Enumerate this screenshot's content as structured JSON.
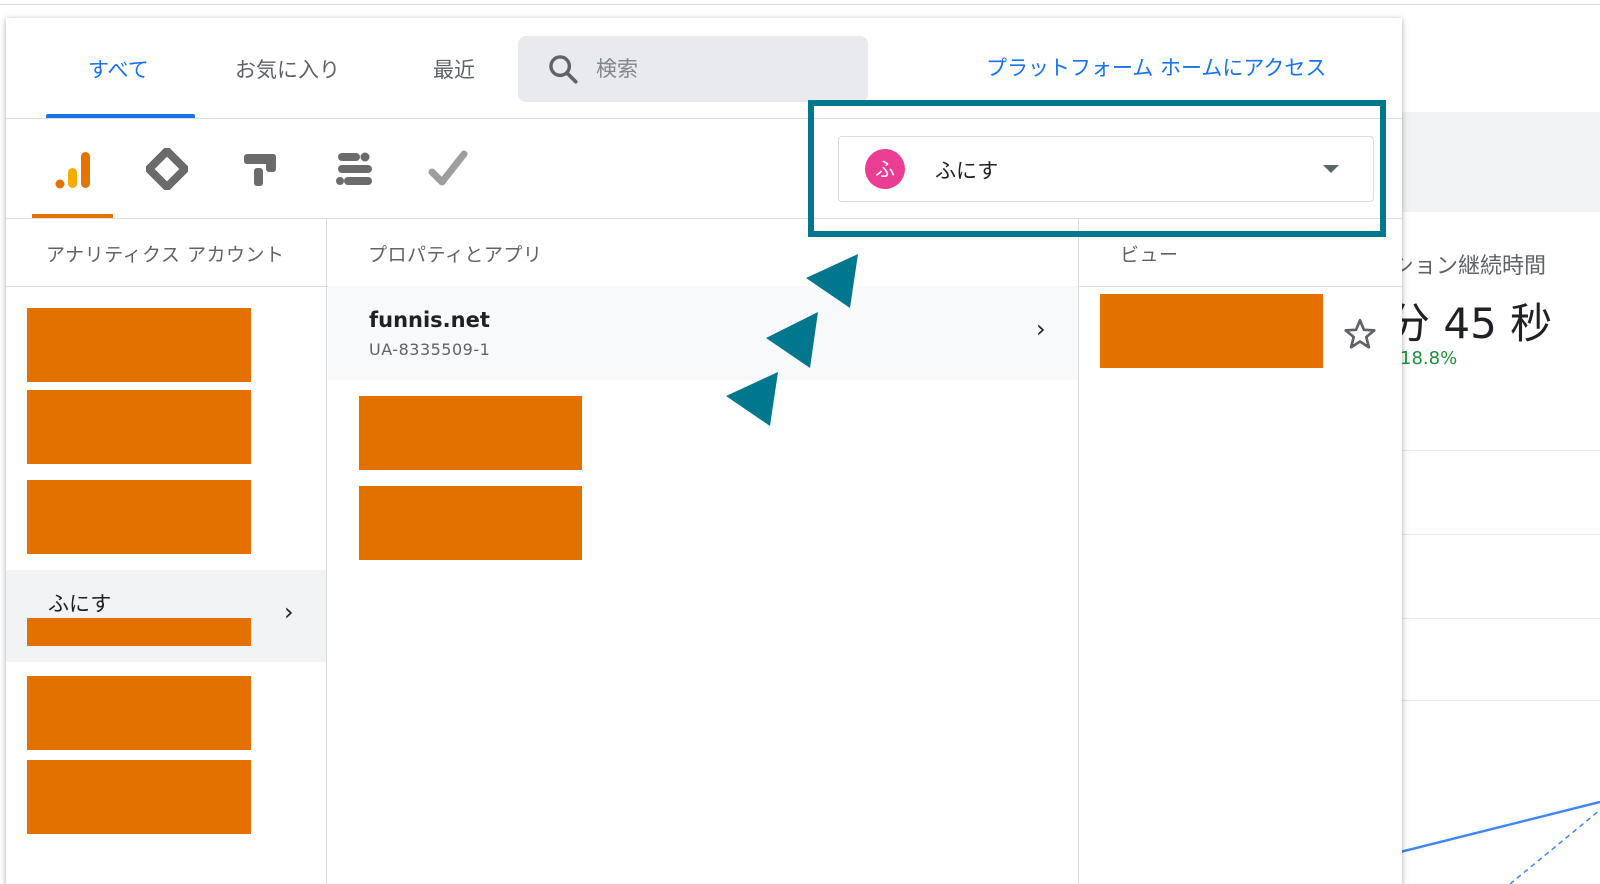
{
  "background": {
    "metric_label": "ション継続時間",
    "metric_value": "分 45 秒",
    "metric_change": "18.8%"
  },
  "tabs": [
    {
      "label": "すべて",
      "active": true
    },
    {
      "label": "お気に入り",
      "active": false
    },
    {
      "label": "最近",
      "active": false
    }
  ],
  "search": {
    "placeholder": "検索",
    "value": ""
  },
  "platform_link": "プラットフォーム ホームにアクセス",
  "products": [
    {
      "icon": "analytics-icon",
      "selected": true
    },
    {
      "icon": "tag-manager-icon",
      "selected": false
    },
    {
      "icon": "optimize-icon",
      "selected": false
    },
    {
      "icon": "data-studio-icon",
      "selected": false
    },
    {
      "icon": "surveys-icon",
      "selected": false
    }
  ],
  "account_selector": {
    "avatar": "ふ",
    "name": "ふにす",
    "avatar_color": "#ea3d93"
  },
  "columns": {
    "accounts": {
      "header": "アナリティクス アカウント",
      "selected_label": "ふにす"
    },
    "properties": {
      "header": "プロパティとアプリ",
      "selected_name": "funnis.net",
      "selected_id": "UA-8335509-1"
    },
    "views": {
      "header": "ビュー"
    }
  },
  "colors": {
    "accent": "#1a73e8",
    "analytics_orange": "#e37400",
    "redaction": "#e27100",
    "annotation_teal": "#00778d"
  },
  "chevron": "›"
}
